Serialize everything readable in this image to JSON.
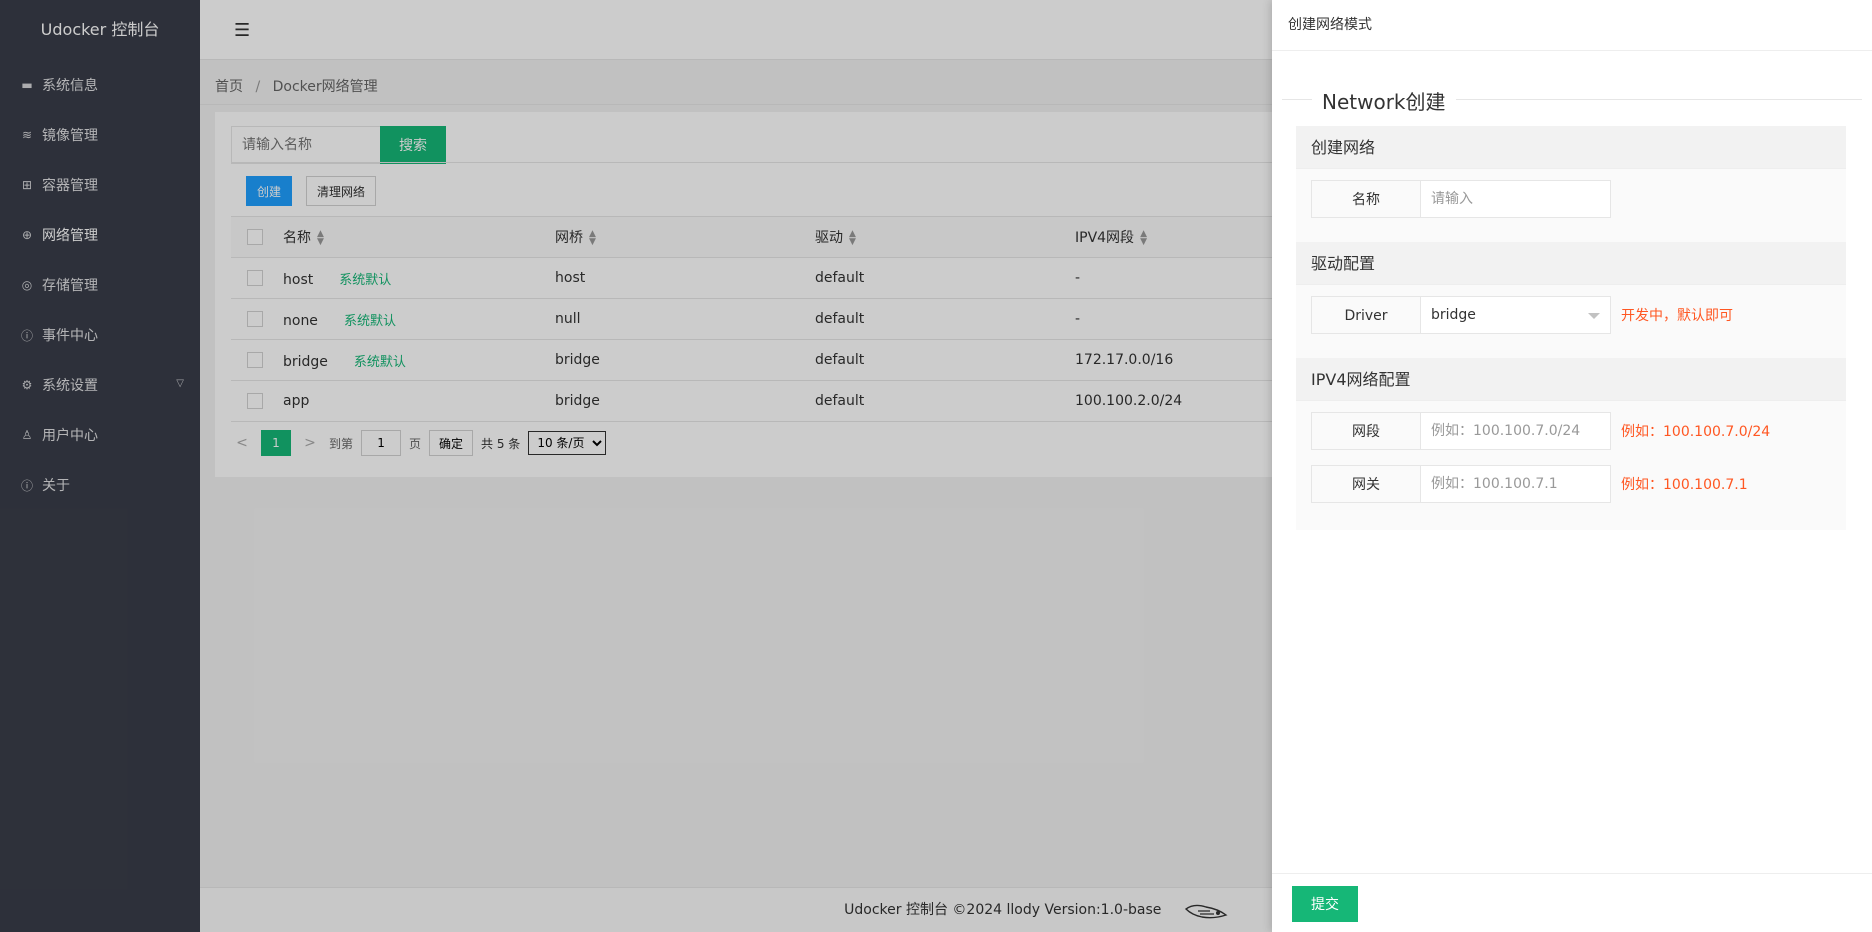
{
  "app": {
    "title": "Udocker 控制台"
  },
  "sidebar": {
    "items": [
      {
        "label": "系统信息",
        "icon": "monitor-icon"
      },
      {
        "label": "镜像管理",
        "icon": "layers-icon"
      },
      {
        "label": "容器管理",
        "icon": "apps-icon"
      },
      {
        "label": "网络管理",
        "icon": "globe-icon"
      },
      {
        "label": "存储管理",
        "icon": "disk-icon"
      },
      {
        "label": "事件中心",
        "icon": "info-icon"
      },
      {
        "label": "系统设置",
        "icon": "gear-icon"
      },
      {
        "label": "用户中心",
        "icon": "user-icon"
      },
      {
        "label": "关于",
        "icon": "info-icon"
      }
    ]
  },
  "breadcrumb": {
    "home": "首页",
    "sep": "/",
    "current": "Docker网络管理"
  },
  "search": {
    "placeholder": "请输入名称",
    "button": "搜索"
  },
  "toolbar": {
    "create": "创建",
    "clean": "清理网络"
  },
  "table": {
    "columns": [
      "名称",
      "网桥",
      "驱动",
      "IPV4网段"
    ],
    "rows": [
      {
        "name": "host",
        "tag": "系统默认",
        "bridge": "host",
        "driver": "default",
        "ipv4": "-"
      },
      {
        "name": "none",
        "tag": "系统默认",
        "bridge": "null",
        "driver": "default",
        "ipv4": "-"
      },
      {
        "name": "bridge",
        "tag": "系统默认",
        "bridge": "bridge",
        "driver": "default",
        "ipv4": "172.17.0.0/16"
      },
      {
        "name": "app",
        "tag": "",
        "bridge": "bridge",
        "driver": "default",
        "ipv4": "100.100.2.0/24"
      }
    ]
  },
  "pager": {
    "prev": "<",
    "current": "1",
    "next": ">",
    "goto_label": "到第",
    "goto_value": "1",
    "page_label": "页",
    "confirm": "确定",
    "total": "共 5 条",
    "page_size": "10 条/页"
  },
  "footer": {
    "text": "Udocker 控制台 ©2024 llody Version:1.0-base"
  },
  "drawer": {
    "title": "创建网络模式",
    "legend": "Network创建",
    "sections": {
      "create": {
        "title": "创建网络",
        "name_label": "名称",
        "name_placeholder": "请输入"
      },
      "driver": {
        "title": "驱动配置",
        "driver_label": "Driver",
        "driver_value": "bridge",
        "driver_hint": "开发中，默认即可"
      },
      "ipv4": {
        "title": "IPV4网络配置",
        "subnet_label": "网段",
        "subnet_placeholder": "例如：100.100.7.0/24",
        "subnet_hint": "例如：100.100.7.0/24",
        "gateway_label": "网关",
        "gateway_placeholder": "例如：100.100.7.1",
        "gateway_hint": "例如：100.100.7.1"
      }
    },
    "submit": "提交"
  },
  "colors": {
    "accent": "#16b777",
    "primary": "#1e9fff",
    "sidebar": "#393d49",
    "hint": "#ff5722"
  }
}
